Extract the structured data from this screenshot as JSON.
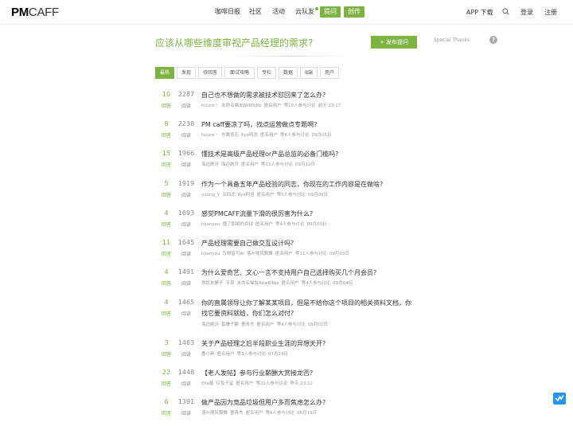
{
  "header": {
    "logo_pm": "PM",
    "logo_caff": "CAFF",
    "nav": [
      "咖啡日报",
      "社区",
      "活动",
      "云队友"
    ],
    "btn_ask": "提问",
    "btn_create": "创作",
    "app_download": "APP 下载",
    "login": "登录",
    "register": "注册"
  },
  "page": {
    "question_title": "应该从哪些维度审视产品经理的需求?",
    "post_button": "+ 发布提问",
    "special_thanks": "Special Thanks",
    "help": "?"
  },
  "tabs": [
    "最热",
    "发现",
    "待回答",
    "面试攻略",
    "专栏",
    "数据",
    "B端",
    "用户"
  ],
  "labels": {
    "answers": "回答",
    "views": "阅读"
  },
  "questions": [
    {
      "answers": "10",
      "views": "2287",
      "title": "自己也不想做的需求被技术怼回来了怎么办?",
      "meta": [
        "future丶",
        "未命名猫友JWtPkXb",
        "匿名用户",
        "等10人参与讨论",
        "前天 23:17"
      ]
    },
    {
      "answers": "8",
      "views": "2238",
      "title": "PM caff要凉了吗，找点运营做点专题啊?",
      "meta": [
        "future丶",
        "东篱揽石",
        "Kyo阿浩",
        "匿名用户",
        "等8人参与讨论",
        "09月05日"
      ]
    },
    {
      "answers": "15",
      "views": "1966",
      "title": "懂技术是高级产品经理or产品总监的必备门槛吗?",
      "meta": [
        "海边刷牙",
        "海边刷牙",
        "匿名用户",
        "等15人参与讨论",
        "09月12日"
      ]
    },
    {
      "answers": "5",
      "views": "1919",
      "title": "作为一个具备五年产品经验的同志，你现在的工作内容是在做啥?",
      "meta": [
        "young_Y",
        "五四北",
        "Kyo阿浩",
        "匿名用户",
        "等5人参与讨论",
        "09月09日"
      ]
    },
    {
      "answers": "4",
      "views": "1693",
      "title": "感觉PMCAFF流量下滑的很厉害为什么?",
      "meta": [
        "hjianyou",
        "懂了那瞬的目狱",
        "匿名用户",
        "等4人参与讨论",
        "09月03日"
      ]
    },
    {
      "answers": "11",
      "views": "1645",
      "title": "产品经理需要自己做交互设计吗?",
      "meta": [
        "hjianyou",
        "万物皆可AI",
        "落叶随风飘舞",
        "匿名用户",
        "等11人参与讨论",
        "09月03日"
      ]
    },
    {
      "answers": "4",
      "views": "1491",
      "title": "为什么爱奇艺、文心一言不支持用户自己选择购买几个月会员?",
      "meta": [
        "常饭友屠子",
        "平菜",
        "未命名猫友AkwB4be",
        "匿名用户",
        "等4人参与讨论",
        "09月04日"
      ]
    },
    {
      "answers": "4",
      "views": "1465",
      "title": "你的直属领导让你了解某某项目，但是不给你这个项目的相关资料文档，你找它要资料就给，你们怎么对付?",
      "meta": [
        "海边刷牙",
        "莫嫌子嗣",
        "曹青杰",
        "匿名用户",
        "等4人参与讨论",
        "09月02日"
      ]
    },
    {
      "answers": "3",
      "views": "1463",
      "title": "关于产品经理之后半段职业生涯的异想天开?",
      "meta": [
        "寡小莽",
        "匿名用户",
        "等3人参与讨论",
        "07月24日"
      ]
    },
    {
      "answers": "22",
      "views": "1448",
      "title": "【老人发帖】参与行业薪酬大赏接龙否?",
      "meta": [
        "Ella酱",
        "红兔子鲨",
        "匿名用户",
        "等22人参与讨论",
        "昨天 23:12"
      ]
    },
    {
      "answers": "6",
      "views": "1391",
      "title": "做产品因为竞品垃圾但用户多而焦虑怎么办?",
      "meta": [
        "落叶随风飘舞",
        "曹青杰",
        "匿名用户",
        "等6人参与讨论",
        "08月19日"
      ]
    }
  ],
  "colors": {
    "accent": "#7cb342",
    "float_button": "#2196f3"
  }
}
